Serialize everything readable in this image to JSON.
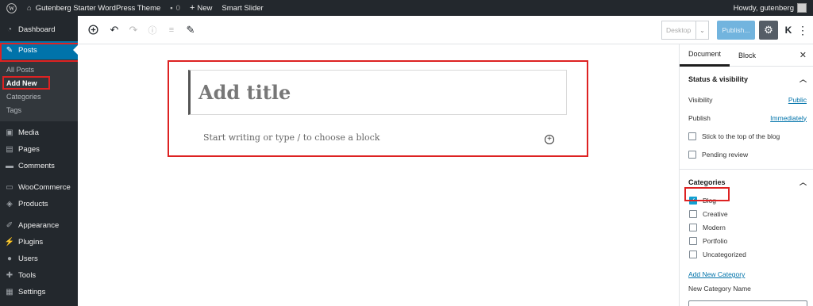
{
  "admin_bar": {
    "site_name": "Gutenberg Starter WordPress Theme",
    "comment_count": "0",
    "new_label": "New",
    "plugin_link": "Smart Slider",
    "greeting": "Howdy, gutenberg"
  },
  "sidebar": {
    "dashboard": "Dashboard",
    "posts": "Posts",
    "posts_sub": [
      "All Posts",
      "Add New",
      "Categories",
      "Tags"
    ],
    "media": "Media",
    "pages": "Pages",
    "comments": "Comments",
    "woocommerce": "WooCommerce",
    "products": "Products",
    "appearance": "Appearance",
    "plugins": "Plugins",
    "users": "Users",
    "tools": "Tools",
    "settings": "Settings"
  },
  "header": {
    "preview_value": "Desktop",
    "publish_label": "Publish...",
    "k_label": "K"
  },
  "editor": {
    "title_placeholder": "Add title",
    "block_placeholder": "Start writing or type / to choose a block"
  },
  "settings_panel": {
    "tabs": [
      "Document",
      "Block"
    ],
    "status_heading": "Status & visibility",
    "visibility_label": "Visibility",
    "visibility_value": "Public",
    "publish_label": "Publish",
    "publish_value": "Immediately",
    "sticky_label": "Stick to the top of the blog",
    "pending_label": "Pending review",
    "categories_heading": "Categories",
    "categories": [
      {
        "name": "Blog",
        "checked": true
      },
      {
        "name": "Creative",
        "checked": false
      },
      {
        "name": "Modern",
        "checked": false
      },
      {
        "name": "Portfolio",
        "checked": false
      },
      {
        "name": "Uncategorized",
        "checked": false
      }
    ],
    "add_new_category": "Add New Category",
    "new_category_name_label": "New Category Name"
  },
  "colors": {
    "admin_dark": "#23282d",
    "accent_blue": "#0073aa",
    "highlight_red": "#dd2222"
  }
}
